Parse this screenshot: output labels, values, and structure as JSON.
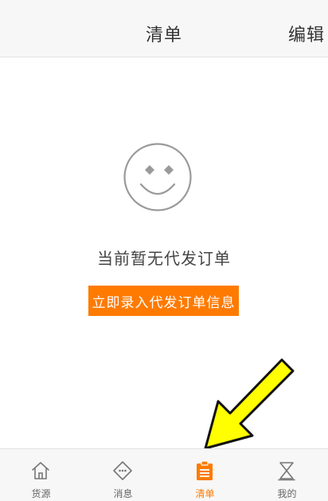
{
  "header": {
    "title": "清单",
    "edit_label": "编辑"
  },
  "empty_state": {
    "icon": "smiley-face-icon",
    "message": "当前暂无代发订单",
    "action_label": "立即录入代发订单信息"
  },
  "tabbar": {
    "items": [
      {
        "label": "货源",
        "icon": "home-icon",
        "active": false
      },
      {
        "label": "消息",
        "icon": "message-icon",
        "active": false
      },
      {
        "label": "清单",
        "icon": "clipboard-list-icon",
        "active": true
      },
      {
        "label": "我的",
        "icon": "hourglass-icon",
        "active": false
      }
    ]
  },
  "colors": {
    "accent": "#ff7a00",
    "annotation_arrow": "#ffff00"
  }
}
